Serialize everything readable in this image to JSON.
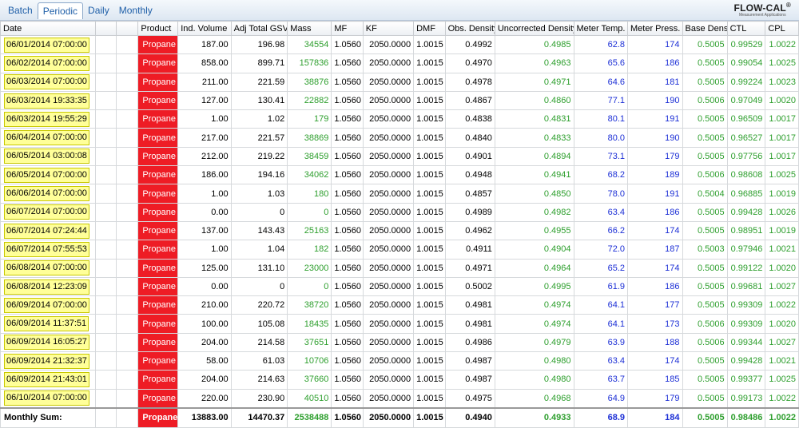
{
  "tabs": [
    "Batch",
    "Periodic",
    "Daily",
    "Monthly"
  ],
  "active_tab": "Periodic",
  "logo": {
    "name": "FLOW-CAL",
    "tagline": "Measurement Applications"
  },
  "columns": [
    "Date",
    "",
    "",
    "Product",
    "Ind. Volume",
    "Adj Total GSV",
    "Mass",
    "MF",
    "KF",
    "DMF",
    "Obs. Density",
    "Uncorrected Density",
    "Meter Temp.",
    "Meter Press.",
    "Base Density",
    "CTL",
    "CPL"
  ],
  "rows": [
    [
      "06/01/2014 07:00:00",
      "",
      "",
      "Propane",
      "187.00",
      "196.98",
      "34554",
      "1.0560",
      "2050.0000",
      "1.0015",
      "0.4992",
      "0.4985",
      "62.8",
      "174",
      "0.5005",
      "0.99529",
      "1.0022"
    ],
    [
      "06/02/2014 07:00:00",
      "",
      "",
      "Propane",
      "858.00",
      "899.71",
      "157836",
      "1.0560",
      "2050.0000",
      "1.0015",
      "0.4970",
      "0.4963",
      "65.6",
      "186",
      "0.5005",
      "0.99054",
      "1.0025"
    ],
    [
      "06/03/2014 07:00:00",
      "",
      "",
      "Propane",
      "211.00",
      "221.59",
      "38876",
      "1.0560",
      "2050.0000",
      "1.0015",
      "0.4978",
      "0.4971",
      "64.6",
      "181",
      "0.5005",
      "0.99224",
      "1.0023"
    ],
    [
      "06/03/2014 19:33:35",
      "",
      "",
      "Propane",
      "127.00",
      "130.41",
      "22882",
      "1.0560",
      "2050.0000",
      "1.0015",
      "0.4867",
      "0.4860",
      "77.1",
      "190",
      "0.5006",
      "0.97049",
      "1.0020"
    ],
    [
      "06/03/2014 19:55:29",
      "",
      "",
      "Propane",
      "1.00",
      "1.02",
      "179",
      "1.0560",
      "2050.0000",
      "1.0015",
      "0.4838",
      "0.4831",
      "80.1",
      "191",
      "0.5005",
      "0.96509",
      "1.0017"
    ],
    [
      "06/04/2014 07:00:00",
      "",
      "",
      "Propane",
      "217.00",
      "221.57",
      "38869",
      "1.0560",
      "2050.0000",
      "1.0015",
      "0.4840",
      "0.4833",
      "80.0",
      "190",
      "0.5005",
      "0.96527",
      "1.0017"
    ],
    [
      "06/05/2014 03:00:08",
      "",
      "",
      "Propane",
      "212.00",
      "219.22",
      "38459",
      "1.0560",
      "2050.0000",
      "1.0015",
      "0.4901",
      "0.4894",
      "73.1",
      "179",
      "0.5005",
      "0.97756",
      "1.0017"
    ],
    [
      "06/05/2014 07:00:00",
      "",
      "",
      "Propane",
      "186.00",
      "194.16",
      "34062",
      "1.0560",
      "2050.0000",
      "1.0015",
      "0.4948",
      "0.4941",
      "68.2",
      "189",
      "0.5006",
      "0.98608",
      "1.0025"
    ],
    [
      "06/06/2014 07:00:00",
      "",
      "",
      "Propane",
      "1.00",
      "1.03",
      "180",
      "1.0560",
      "2050.0000",
      "1.0015",
      "0.4857",
      "0.4850",
      "78.0",
      "191",
      "0.5004",
      "0.96885",
      "1.0019"
    ],
    [
      "06/07/2014 07:00:00",
      "",
      "",
      "Propane",
      "0.00",
      "0",
      "0",
      "1.0560",
      "2050.0000",
      "1.0015",
      "0.4989",
      "0.4982",
      "63.4",
      "186",
      "0.5005",
      "0.99428",
      "1.0026"
    ],
    [
      "06/07/2014 07:24:44",
      "",
      "",
      "Propane",
      "137.00",
      "143.43",
      "25163",
      "1.0560",
      "2050.0000",
      "1.0015",
      "0.4962",
      "0.4955",
      "66.2",
      "174",
      "0.5005",
      "0.98951",
      "1.0019"
    ],
    [
      "06/07/2014 07:55:53",
      "",
      "",
      "Propane",
      "1.00",
      "1.04",
      "182",
      "1.0560",
      "2050.0000",
      "1.0015",
      "0.4911",
      "0.4904",
      "72.0",
      "187",
      "0.5003",
      "0.97946",
      "1.0021"
    ],
    [
      "06/08/2014 07:00:00",
      "",
      "",
      "Propane",
      "125.00",
      "131.10",
      "23000",
      "1.0560",
      "2050.0000",
      "1.0015",
      "0.4971",
      "0.4964",
      "65.2",
      "174",
      "0.5005",
      "0.99122",
      "1.0020"
    ],
    [
      "06/08/2014 12:23:09",
      "",
      "",
      "Propane",
      "0.00",
      "0",
      "0",
      "1.0560",
      "2050.0000",
      "1.0015",
      "0.5002",
      "0.4995",
      "61.9",
      "186",
      "0.5005",
      "0.99681",
      "1.0027"
    ],
    [
      "06/09/2014 07:00:00",
      "",
      "",
      "Propane",
      "210.00",
      "220.72",
      "38720",
      "1.0560",
      "2050.0000",
      "1.0015",
      "0.4981",
      "0.4974",
      "64.1",
      "177",
      "0.5005",
      "0.99309",
      "1.0022"
    ],
    [
      "06/09/2014 11:37:51",
      "",
      "",
      "Propane",
      "100.00",
      "105.08",
      "18435",
      "1.0560",
      "2050.0000",
      "1.0015",
      "0.4981",
      "0.4974",
      "64.1",
      "173",
      "0.5006",
      "0.99309",
      "1.0020"
    ],
    [
      "06/09/2014 16:05:27",
      "",
      "",
      "Propane",
      "204.00",
      "214.58",
      "37651",
      "1.0560",
      "2050.0000",
      "1.0015",
      "0.4986",
      "0.4979",
      "63.9",
      "188",
      "0.5006",
      "0.99344",
      "1.0027"
    ],
    [
      "06/09/2014 21:32:37",
      "",
      "",
      "Propane",
      "58.00",
      "61.03",
      "10706",
      "1.0560",
      "2050.0000",
      "1.0015",
      "0.4987",
      "0.4980",
      "63.4",
      "174",
      "0.5005",
      "0.99428",
      "1.0021"
    ],
    [
      "06/09/2014 21:43:01",
      "",
      "",
      "Propane",
      "204.00",
      "214.63",
      "37660",
      "1.0560",
      "2050.0000",
      "1.0015",
      "0.4987",
      "0.4980",
      "63.7",
      "185",
      "0.5005",
      "0.99377",
      "1.0025"
    ],
    [
      "06/10/2014 07:00:00",
      "",
      "",
      "Propane",
      "220.00",
      "230.90",
      "40510",
      "1.0560",
      "2050.0000",
      "1.0015",
      "0.4975",
      "0.4968",
      "64.9",
      "179",
      "0.5005",
      "0.99173",
      "1.0022"
    ]
  ],
  "summary": [
    "Monthly Sum:",
    "",
    "",
    "Propane",
    "13883.00",
    "14470.37",
    "2538488",
    "1.0560",
    "2050.0000",
    "1.0015",
    "0.4940",
    "0.4933",
    "68.9",
    "184",
    "0.5005",
    "0.98486",
    "1.0022"
  ],
  "colors": {
    "product_bg": "#ee1c25",
    "date_bg": "#ffff99",
    "green": "#2e9f2e",
    "blue": "#1c2fd6"
  }
}
